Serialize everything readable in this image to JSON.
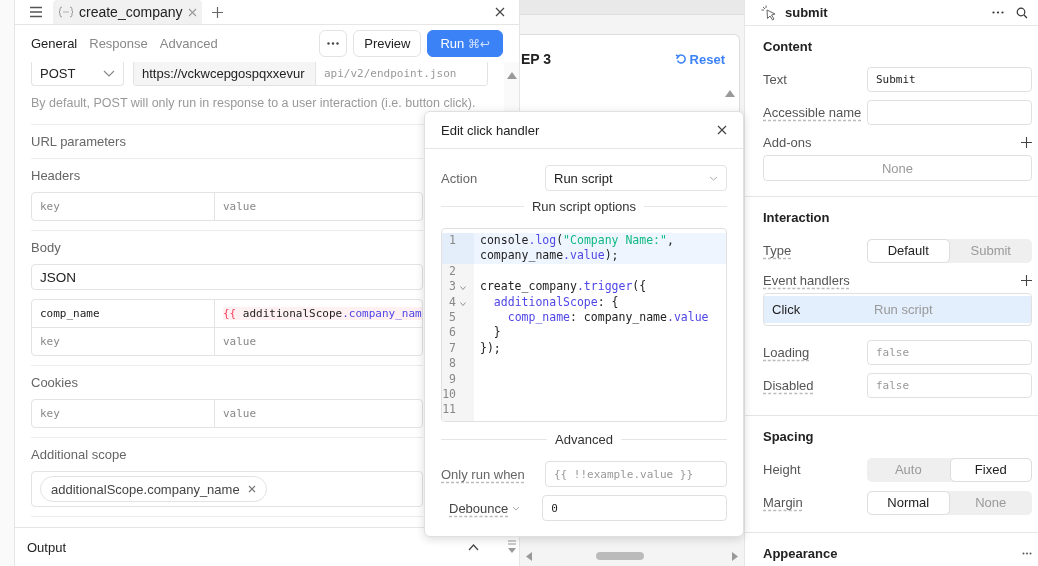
{
  "query_tabs": [
    {
      "title": "create_company",
      "selected": true
    }
  ],
  "editor": {
    "tabs": [
      {
        "label": "General",
        "selected": true
      },
      {
        "label": "Response",
        "selected": false
      },
      {
        "label": "Advanced",
        "selected": false
      }
    ],
    "preview_button": "Preview",
    "run_button": {
      "label": "Run",
      "shortcut": "⌘↩"
    },
    "method": "POST",
    "url": "https://vckwcepgospqxxevur",
    "path_placeholder": "api/v2/endpoint.json",
    "hint": "By default, POST will only run in response to a user interaction (i.e. button click).",
    "sections": [
      {
        "kind": "collapsed",
        "title": "URL parameters"
      },
      {
        "kind": "pairs",
        "title": "Headers",
        "rows": [
          {
            "key_placeholder": "key",
            "value_placeholder": "value"
          }
        ]
      },
      {
        "kind": "pairs",
        "title": "Body",
        "format": "JSON",
        "rows": [
          {
            "key": "comp_name",
            "value": [
              {
                "text": "{{",
                "kind": "brace"
              },
              {
                "text": " additionalScope",
                "kind": "plain"
              },
              {
                "text": ".company_nam",
                "kind": "prop"
              }
            ]
          },
          {
            "key_placeholder": "key",
            "value_placeholder": "value"
          }
        ]
      },
      {
        "kind": "pairs",
        "title": "Cookies",
        "rows": [
          {
            "key_placeholder": "key",
            "value_placeholder": "value"
          }
        ]
      },
      {
        "kind": "tags",
        "title": "Additional scope",
        "tags": [
          "additionalScope.company_name"
        ]
      }
    ],
    "output": "Output"
  },
  "canvas": {
    "card_title": "EP 3",
    "reset": "Reset"
  },
  "dialog": {
    "title": "Edit click handler",
    "action_label": "Action",
    "action_value": "Run script",
    "options_title": "Run script options",
    "code": [
      {
        "n": "1",
        "fold": false,
        "active": true,
        "segs": [
          {
            "text": "console",
            "kind": "plain"
          },
          {
            "text": ".log",
            "kind": "method"
          },
          {
            "text": "(",
            "kind": "plain"
          },
          {
            "text": "\"Company Name:\"",
            "kind": "string"
          },
          {
            "text": ", company_name",
            "kind": "plain"
          },
          {
            "text": ".value",
            "kind": "method"
          },
          {
            "text": ");",
            "kind": "plain"
          }
        ]
      },
      {
        "n": "2",
        "fold": false,
        "active": false
      },
      {
        "n": "3",
        "fold": true,
        "active": false,
        "segs": [
          {
            "text": "create_company",
            "kind": "plain"
          },
          {
            "text": ".trigger",
            "kind": "method"
          },
          {
            "text": "({",
            "kind": "plain"
          }
        ]
      },
      {
        "n": "4",
        "fold": true,
        "active": false,
        "segs": [
          {
            "text": "  additionalScope",
            "kind": "method"
          },
          {
            "text": ": {",
            "kind": "plain"
          }
        ]
      },
      {
        "n": "5",
        "fold": false,
        "active": false,
        "segs": [
          {
            "text": "    comp_name",
            "kind": "method"
          },
          {
            "text": ": company_name",
            "kind": "plain"
          },
          {
            "text": ".value",
            "kind": "method"
          }
        ]
      },
      {
        "n": "6",
        "fold": false,
        "active": false,
        "segs": [
          {
            "text": "  }",
            "kind": "plain"
          }
        ]
      },
      {
        "n": "7",
        "fold": false,
        "active": false,
        "segs": [
          {
            "text": "});",
            "kind": "plain"
          }
        ]
      },
      {
        "n": "8",
        "fold": false,
        "active": false
      },
      {
        "n": "9",
        "fold": false,
        "active": false
      },
      {
        "n": "10",
        "fold": false,
        "active": false
      },
      {
        "n": "11",
        "fold": false,
        "active": false
      }
    ],
    "advanced_title": "Advanced",
    "only_run_label": "Only run when",
    "only_run_placeholder": "{{ !!example.value }}",
    "debounce_label": "Debounce",
    "debounce_value": "0"
  },
  "inspector": {
    "title": "submit",
    "sections": [
      {
        "title": "Content",
        "menu": false,
        "rows": [
          {
            "kind": "field",
            "label": "Text",
            "tooltip": false,
            "value": "Submit"
          },
          {
            "kind": "field",
            "label": "Accessible name",
            "tooltip": true
          },
          {
            "kind": "addons",
            "label": "Add-ons",
            "tooltip": false,
            "empty": "None"
          }
        ]
      },
      {
        "title": "Interaction",
        "menu": false,
        "rows": [
          {
            "kind": "segmented",
            "label": "Type",
            "tooltip": true,
            "options": [
              {
                "label": "Default",
                "selected": true
              },
              {
                "label": "Submit",
                "selected": false
              }
            ]
          },
          {
            "kind": "handlers",
            "label": "Event handlers",
            "tooltip": true,
            "items": [
              {
                "event": "Click",
                "action": "Run script",
                "selected": true
              }
            ]
          },
          {
            "kind": "field",
            "label": "Loading",
            "tooltip": true,
            "placeholder": "false"
          },
          {
            "kind": "field",
            "label": "Disabled",
            "tooltip": true,
            "placeholder": "false"
          }
        ]
      },
      {
        "title": "Spacing",
        "menu": false,
        "rows": [
          {
            "kind": "segmented",
            "label": "Height",
            "tooltip": false,
            "options": [
              {
                "label": "Auto",
                "selected": false
              },
              {
                "label": "Fixed",
                "selected": true
              }
            ]
          },
          {
            "kind": "segmented",
            "label": "Margin",
            "tooltip": true,
            "options": [
              {
                "label": "Normal",
                "selected": true
              },
              {
                "label": "None",
                "selected": false
              }
            ]
          }
        ]
      },
      {
        "title": "Appearance",
        "menu": true
      }
    ]
  }
}
